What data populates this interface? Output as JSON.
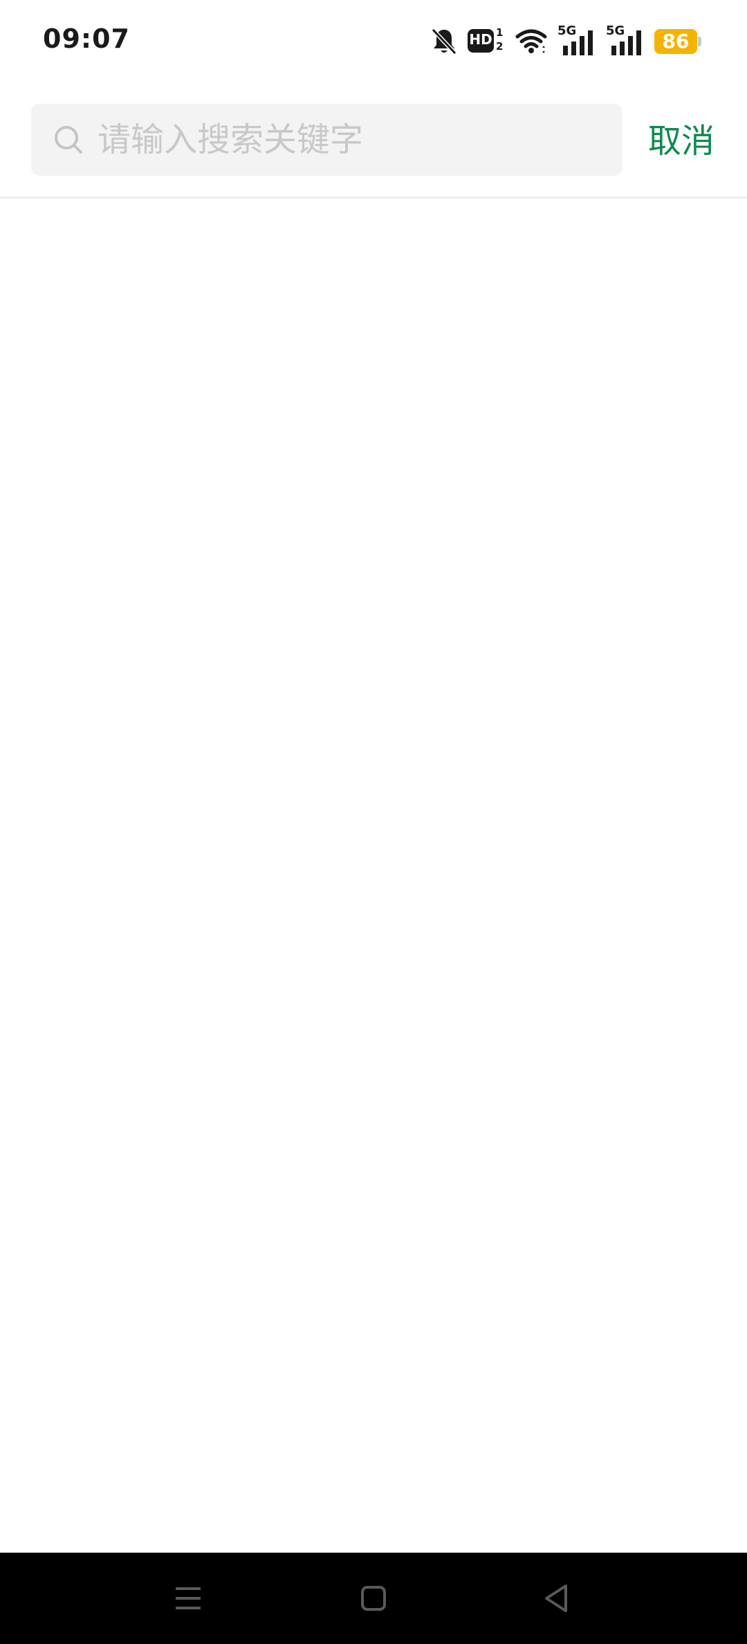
{
  "status_bar": {
    "time": "09:07",
    "icons": [
      "bell-off-icon",
      "hd-voice-icon",
      "wifi-icon",
      "signal-5g-icon",
      "signal-5g-icon",
      "battery-icon"
    ],
    "hd_label": "HD",
    "hd_sim_1": "1",
    "hd_sim_2": "2",
    "signal_1_label": "5G",
    "signal_2_label": "5G",
    "battery_level": "86",
    "battery_color": "#f5b301"
  },
  "search": {
    "placeholder": "请输入搜索关键字",
    "value": "",
    "icon": "search-icon",
    "cancel_label": "取消",
    "accent_color": "#0c8a4e"
  },
  "nav_bar": {
    "buttons": [
      "menu-icon",
      "home-icon",
      "back-icon"
    ]
  }
}
